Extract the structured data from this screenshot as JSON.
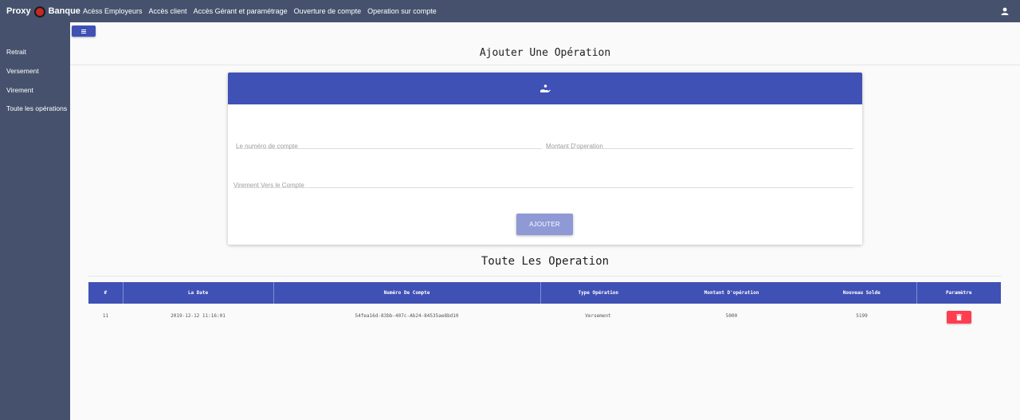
{
  "nav": {
    "brand_left": "Proxy",
    "brand_right": "Banque",
    "links": [
      "Acèss Employeurs",
      "Accès client",
      "Accès Gérant et paramétrage",
      "Ouverture de compte",
      "Operation sur compte"
    ]
  },
  "sidebar": {
    "items": [
      {
        "label": "Retrait"
      },
      {
        "label": "Versement"
      },
      {
        "label": "Virement"
      },
      {
        "label": "Toute les opérations"
      }
    ]
  },
  "form": {
    "title": "Ajouter Une Opération",
    "fields": {
      "account_number_placeholder": "Le numéro de compte",
      "amount_placeholder": "Montant D'operation",
      "transfer_to_placeholder": "Virement Vers le Compte"
    },
    "submit_label": "AJOUTER"
  },
  "operations": {
    "title": "Toute Les Operation",
    "columns": [
      "#",
      "La Date",
      "Numéro De Compte",
      "Type Opération",
      "Montant D'opération",
      "Nouveau Solde",
      "Paramètre"
    ],
    "rows": [
      {
        "id": "11",
        "date": "2019-12-12 11:16:01",
        "account": "54fea16d-83bb-407c-Ab24-84535ae8bd10",
        "type": "Versement",
        "amount": "5000",
        "balance": "5199"
      }
    ]
  },
  "colors": {
    "nav_bg": "#46526d",
    "primary": "#3f51b5",
    "primary_light": "#8e99d6",
    "danger": "#ff3d4f"
  }
}
